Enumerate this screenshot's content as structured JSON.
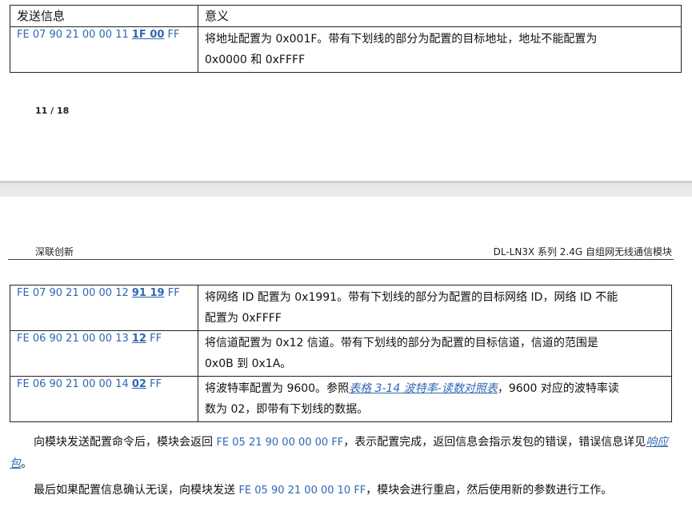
{
  "table_top": {
    "header": {
      "col1": "发送信息",
      "col2": "意义"
    },
    "row": {
      "code_prefix": "FE 07 90 21 00 00 11 ",
      "code_underlined": "1F 00",
      "code_suffix": " FF",
      "desc_line1": "将地址配置为 0x001F。带有下划线的部分为配置的目标地址，地址不能配置为",
      "desc_line2": "0x0000 和 0xFFFF"
    }
  },
  "page_number": "11 / 18",
  "running_header": {
    "left": "深联创新",
    "right": "DL-LN3X 系列 2.4G 自组网无线通信模块"
  },
  "table_bottom": {
    "rows": [
      {
        "code_prefix": "FE 07 90 21 00 00 12 ",
        "code_underlined": "91 19",
        "code_suffix": " FF",
        "desc_line1": "将网络 ID 配置为 0x1991。带有下划线的部分为配置的目标网络 ID，网络 ID 不能",
        "desc_line2": "配置为 0xFFFF"
      },
      {
        "code_prefix": "FE 06 90 21 00 00 13 ",
        "code_underlined": "12",
        "code_suffix": " FF",
        "desc_line1": "将信道配置为 0x12 信道。带有下划线的部分为配置的目标信道，信道的范围是",
        "desc_line2": "0x0B 到 0x1A。"
      },
      {
        "code_prefix": "FE 06 90 21 00 00 14 ",
        "code_underlined": "02",
        "code_suffix": " FF",
        "desc_line1_pre": "将波特率配置为 9600。参照",
        "desc_link": "表格 3-14 波特率-读数对照表",
        "desc_line1_post": "，9600 对应的波特率读",
        "desc_line2": "数为 02，即带有下划线的数据。"
      }
    ]
  },
  "paragraphs": {
    "p1_pre": "向模块发送配置命令后，模块会返回 ",
    "p1_code": "FE 05 21 90 00 00 00 FF",
    "p1_mid": "，表示配置完成，返回信息会指示发包的错误，错误信息详见",
    "p1_link": "响应包",
    "p1_post": "。",
    "p2_pre": "最后如果配置信息确认无误，向模块发送 ",
    "p2_code": "FE 05 90 21 00 00 10 FF",
    "p2_post": "，模块会进行重启，然后使用新的参数进行工作。"
  }
}
